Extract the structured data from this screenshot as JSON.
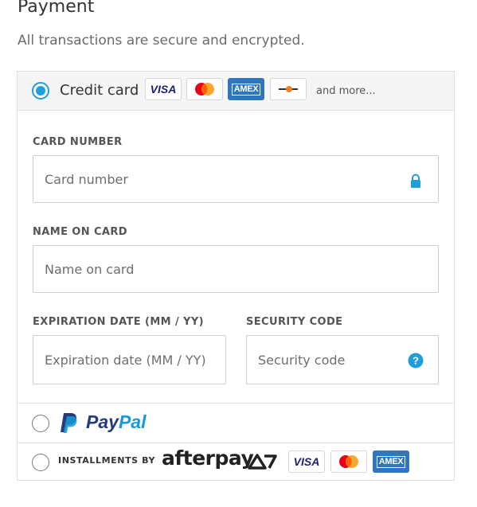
{
  "heading": "Payment",
  "subheading": "All transactions are secure and encrypted.",
  "credit_card": {
    "label": "Credit card",
    "more": "and more...",
    "logos": [
      "visa",
      "mastercard",
      "amex",
      "discover"
    ],
    "visa_text": "VISA",
    "amex_text": "AMEX"
  },
  "fields": {
    "card_number": {
      "label": "CARD NUMBER",
      "placeholder": "Card number",
      "value": ""
    },
    "name_on_card": {
      "label": "NAME ON CARD",
      "placeholder": "Name on card",
      "value": ""
    },
    "expiration": {
      "label": "EXPIRATION DATE (MM / YY)",
      "placeholder": "Expiration date (MM / YY)",
      "value": ""
    },
    "security_code": {
      "label": "SECURITY CODE",
      "placeholder": "Security code",
      "value": ""
    }
  },
  "paypal": {
    "brand_pay": "Pay",
    "brand_pal": "Pal"
  },
  "afterpay": {
    "prefix": "INSTALLMENTS BY",
    "brand": "afterpay",
    "visa_text": "VISA",
    "amex_text": "AMEX"
  },
  "colors": {
    "accent": "#1f9fd8",
    "visa_blue": "#1a1f71",
    "amex_blue": "#2e77bc",
    "paypal_dark": "#253b80",
    "paypal_light": "#179bd7",
    "mc_red": "#eb001b",
    "mc_orange": "#f79e1b"
  }
}
